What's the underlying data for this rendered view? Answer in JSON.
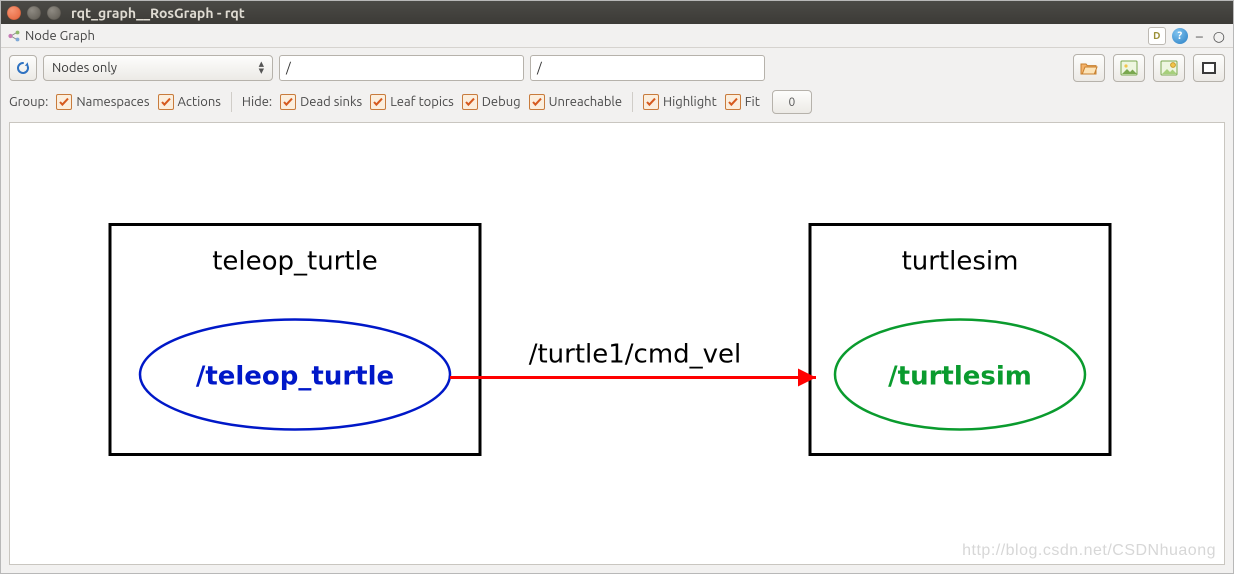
{
  "window": {
    "title": "rqt_graph__RosGraph - rqt"
  },
  "panel": {
    "title": "Node Graph",
    "debug_badge": "D",
    "help": "?",
    "dash": "–",
    "ring": "○"
  },
  "toolbar": {
    "node_filter": "Nodes only",
    "filter1": "/",
    "filter2": "/"
  },
  "options": {
    "group_label": "Group:",
    "hide_label": "Hide:",
    "namespaces": "Namespaces",
    "actions": "Actions",
    "dead_sinks": "Dead sinks",
    "leaf_topics": "Leaf topics",
    "debug": "Debug",
    "unreachable": "Unreachable",
    "highlight": "Highlight",
    "fit": "Fit",
    "nested_count": "0"
  },
  "graph": {
    "group1_label": "teleop_turtle",
    "node1_label": "/teleop_turtle",
    "group2_label": "turtlesim",
    "node2_label": "/turtlesim",
    "topic_label": "/turtle1/cmd_vel"
  },
  "watermark": "http://blog.csdn.net/CSDNhuaong"
}
